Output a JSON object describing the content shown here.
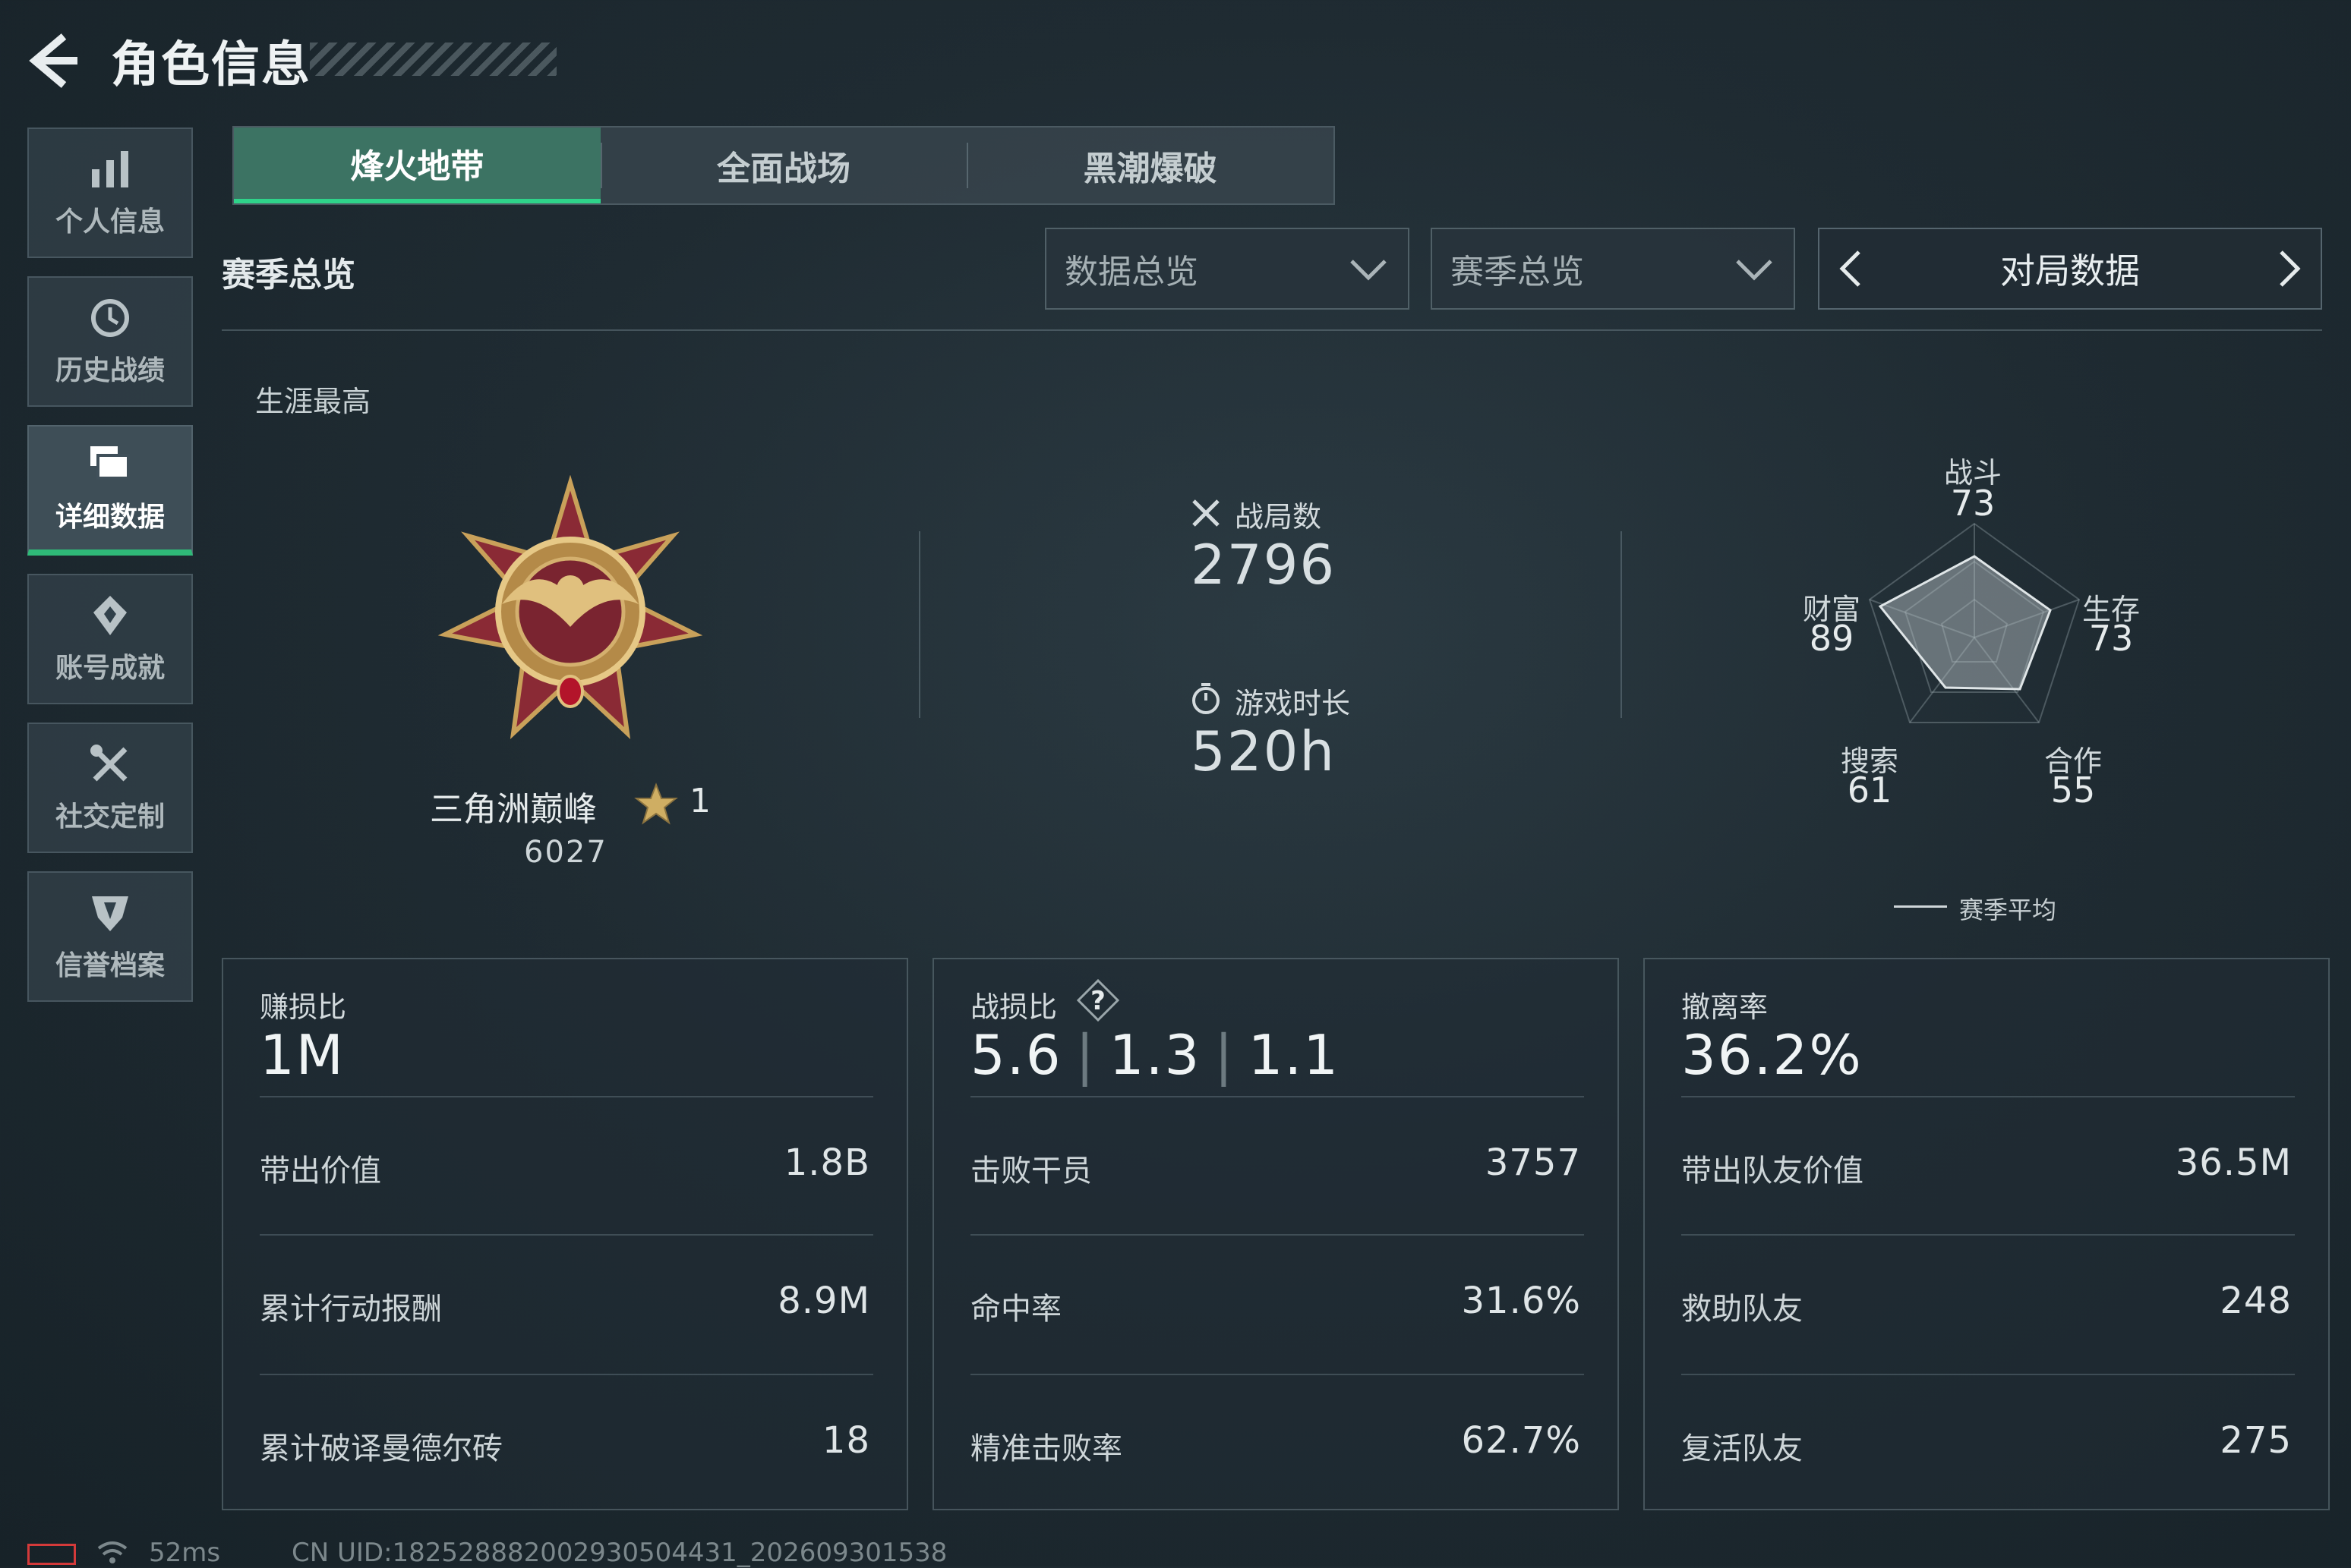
{
  "header": {
    "title": "角色信息"
  },
  "sidebar": {
    "items": [
      {
        "label": "个人信息",
        "icon": "bar-chart-icon"
      },
      {
        "label": "历史战绩",
        "icon": "history-clock-icon"
      },
      {
        "label": "详细数据",
        "icon": "stacked-cards-icon",
        "active": true
      },
      {
        "label": "账号成就",
        "icon": "achievement-icon"
      },
      {
        "label": "社交定制",
        "icon": "crossed-tools-icon"
      },
      {
        "label": "信誉档案",
        "icon": "shield-credit-icon"
      }
    ]
  },
  "tabs": [
    {
      "label": "烽火地带",
      "active": true
    },
    {
      "label": "全面战场"
    },
    {
      "label": "黑潮爆破"
    }
  ],
  "filters": {
    "section_title": "赛季总览",
    "dropdown1": "数据总览",
    "dropdown2": "赛季总览",
    "pager_label": "对局数据"
  },
  "career": {
    "label": "生涯最高",
    "rank_name": "三角洲巅峰",
    "rank_level": "1",
    "rank_score": "6027"
  },
  "stats": {
    "matches_label": "战局数",
    "matches_value": "2796",
    "playtime_label": "游戏时长",
    "playtime_value": "520h"
  },
  "radar": {
    "axes": [
      {
        "name": "战斗",
        "value": "73"
      },
      {
        "name": "生存",
        "value": "73"
      },
      {
        "name": "合作",
        "value": "55"
      },
      {
        "name": "搜索",
        "value": "61"
      },
      {
        "name": "财富",
        "value": "89"
      }
    ],
    "legend": "赛季平均"
  },
  "cards": [
    {
      "title": "赚损比",
      "main": "1M",
      "rows": [
        {
          "label": "带出价值",
          "value": "1.8B"
        },
        {
          "label": "累计行动报酬",
          "value": "8.9M"
        },
        {
          "label": "累计破译曼德尔砖",
          "value": "18"
        }
      ]
    },
    {
      "title": "战损比",
      "main_parts": [
        "5.6",
        "1.3",
        "1.1"
      ],
      "rows": [
        {
          "label": "击败干员",
          "value": "3757"
        },
        {
          "label": "命中率",
          "value": "31.6%"
        },
        {
          "label": "精准击败率",
          "value": "62.7%"
        }
      ]
    },
    {
      "title": "撤离率",
      "main": "36.2%",
      "rows": [
        {
          "label": "带出队友价值",
          "value": "36.5M"
        },
        {
          "label": "救助队友",
          "value": "248"
        },
        {
          "label": "复活队友",
          "value": "275"
        }
      ]
    }
  ],
  "status_bar": {
    "ping": "52ms",
    "uid": "CN UID:1825288820029305044​31_202609301538"
  },
  "colors": {
    "accent_green": "#2fb978",
    "active_tab": "#3c7363",
    "battery_low": "#d43a3a"
  }
}
